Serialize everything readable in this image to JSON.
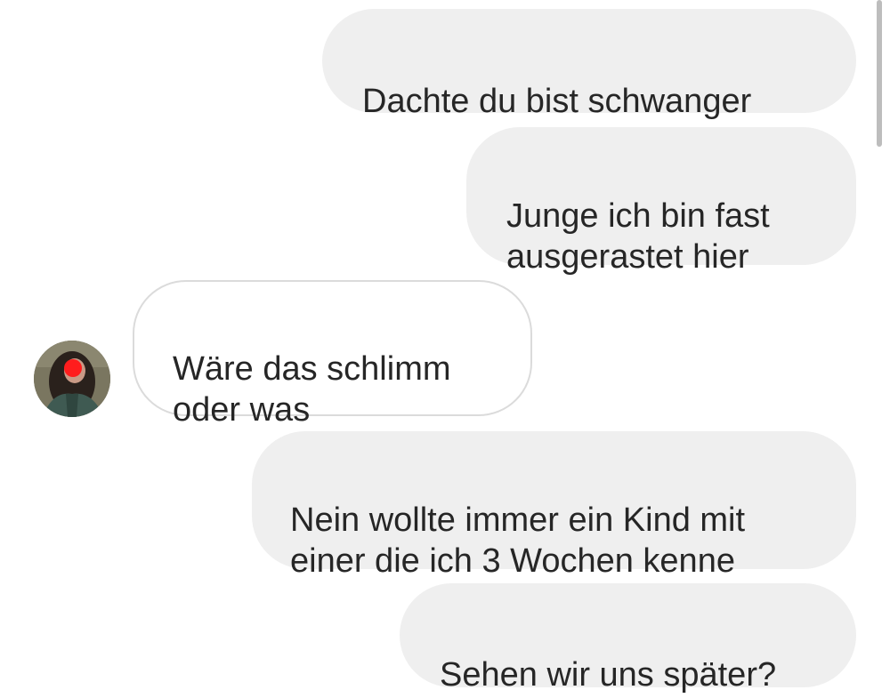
{
  "conversation": {
    "messages": [
      {
        "sender": "me",
        "text": "Dachte du bist schwanger"
      },
      {
        "sender": "me",
        "text": "Junge ich bin fast\nausgerastet hier"
      },
      {
        "sender": "other",
        "text": "Wäre das schlimm\noder was"
      },
      {
        "sender": "me",
        "text": "Nein wollte immer ein Kind mit\neiner die ich 3 Wochen kenne"
      },
      {
        "sender": "me",
        "text": "Sehen wir uns später?"
      }
    ]
  },
  "colors": {
    "outgoing_bubble": "#efefef",
    "incoming_bubble_border": "#dbdbdb",
    "text": "#262626",
    "background": "#ffffff"
  },
  "icons": {
    "avatar": "profile-avatar-icon"
  }
}
